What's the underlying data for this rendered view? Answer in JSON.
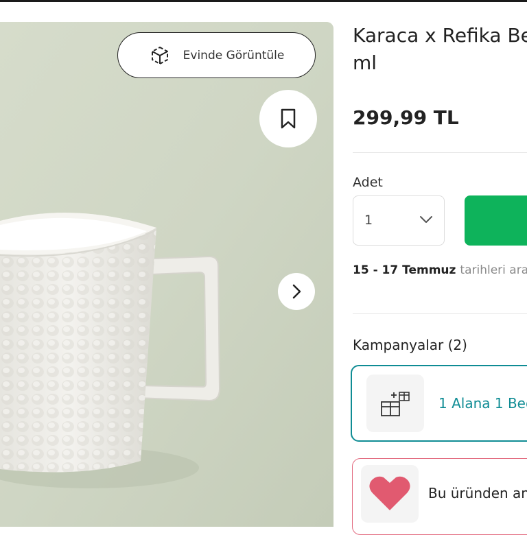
{
  "product": {
    "title_line1": "Karaca x Refika Be",
    "title_line2": "ml",
    "price": "299,99 TL"
  },
  "image_overlay": {
    "ar_view_label": "Evinde Görüntüle",
    "ar_icon": "ar-cube-icon",
    "bookmark_icon": "bookmark-icon",
    "next_icon": "chevron-right-icon"
  },
  "purchase": {
    "quantity_label": "Adet",
    "quantity_value": "1",
    "add_button_color": "#0eb35b"
  },
  "delivery": {
    "date_range": "15 - 17 Temmuz",
    "rest": "tarihleri ara"
  },
  "campaigns": {
    "title": "Kampanyalar (2)",
    "card_text": "1 Alana 1 Bed",
    "card_icon": "gift-box-icon",
    "accent": "#0f8c94"
  },
  "favorite": {
    "text": "Bu üründen an",
    "icon": "heart-icon",
    "accent": "#e15a70"
  }
}
